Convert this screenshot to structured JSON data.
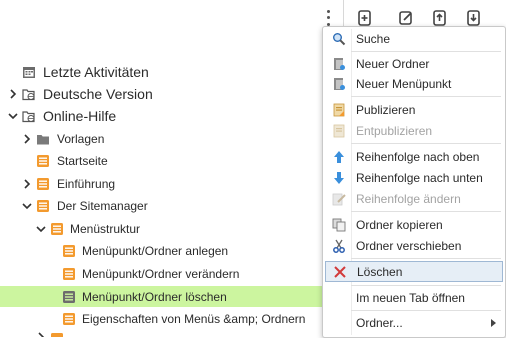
{
  "toolbar": {
    "icons": [
      "more-vertical-icon",
      "add-page-icon",
      "edit-page-icon",
      "upload-page-icon",
      "download-page-icon"
    ]
  },
  "tree": {
    "items": [
      {
        "label": "Letzte Aktivitäten",
        "icon": "calendar-icon"
      },
      {
        "label": "Deutsche Version",
        "icon": "globe-folder-icon"
      },
      {
        "label": "Online-Hilfe",
        "icon": "globe-folder-icon"
      },
      {
        "label": "Vorlagen",
        "icon": "folder-icon"
      },
      {
        "label": "Startseite",
        "icon": "page-icon"
      },
      {
        "label": "Einführung",
        "icon": "page-icon"
      },
      {
        "label": "Der Sitemanager",
        "icon": "page-icon"
      },
      {
        "label": "Menüstruktur",
        "icon": "page-icon"
      },
      {
        "label": "Menüpunkt/Ordner anlegen",
        "icon": "page-icon"
      },
      {
        "label": "Menüpunkt/Ordner verändern",
        "icon": "page-icon"
      },
      {
        "label": "Menüpunkt/Ordner löschen",
        "icon": "page-icon"
      },
      {
        "label": "Eigenschaften von Menüs &amp; Ordnern",
        "icon": "page-icon"
      }
    ]
  },
  "context_menu": {
    "items": [
      {
        "label": "Suche",
        "icon": "search-icon",
        "enabled": true
      },
      {
        "label": "Neuer Ordner",
        "icon": "new-folder-icon",
        "enabled": true
      },
      {
        "label": "Neuer Menüpunkt",
        "icon": "new-menu-item-icon",
        "enabled": true
      },
      {
        "label": "Publizieren",
        "icon": "publish-icon",
        "enabled": true
      },
      {
        "label": "Entpublizieren",
        "icon": "unpublish-icon",
        "enabled": false
      },
      {
        "label": "Reihenfolge nach oben",
        "icon": "arrow-up-icon",
        "enabled": true
      },
      {
        "label": "Reihenfolge nach unten",
        "icon": "arrow-down-icon",
        "enabled": true
      },
      {
        "label": "Reihenfolge ändern",
        "icon": "reorder-icon",
        "enabled": false
      },
      {
        "label": "Ordner kopieren",
        "icon": "copy-icon",
        "enabled": true
      },
      {
        "label": "Ordner verschieben",
        "icon": "cut-icon",
        "enabled": true
      },
      {
        "label": "Löschen",
        "icon": "delete-icon",
        "enabled": true
      },
      {
        "label": "Im neuen Tab öffnen",
        "icon": "",
        "enabled": true
      },
      {
        "label": "Ordner...",
        "icon": "",
        "enabled": true
      }
    ]
  },
  "colors": {
    "selected_row": "#ccf59f",
    "page_icon": "#f39a2e",
    "folder_icon": "#7a7a7a",
    "delete_icon": "#d23b3b",
    "arrow_icon": "#3a8fdc"
  }
}
